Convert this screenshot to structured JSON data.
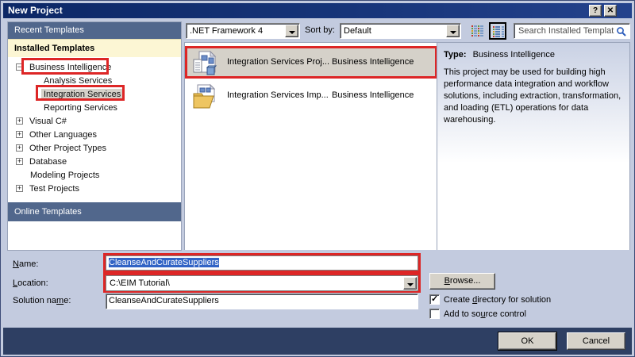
{
  "window": {
    "title": "New Project",
    "help_glyph": "?",
    "close_glyph": "✕"
  },
  "toolbar": {
    "framework_value": ".NET Framework 4",
    "sort_label": "Sort by:",
    "sort_value": "Default",
    "search_placeholder": "Search Installed Templat"
  },
  "sidebar": {
    "recent_header": "Recent Templates",
    "installed_header": "Installed Templates",
    "online_header": "Online Templates",
    "tree": [
      {
        "label": "Business Intelligence",
        "exp": "−"
      },
      {
        "label": "Analysis Services",
        "exp": ""
      },
      {
        "label": "Integration Services",
        "exp": ""
      },
      {
        "label": "Reporting Services",
        "exp": ""
      },
      {
        "label": "Visual C#",
        "exp": "+"
      },
      {
        "label": "Other Languages",
        "exp": "+"
      },
      {
        "label": "Other Project Types",
        "exp": "+"
      },
      {
        "label": "Database",
        "exp": "+"
      },
      {
        "label": "Modeling Projects",
        "exp": ""
      },
      {
        "label": "Test Projects",
        "exp": "+"
      }
    ]
  },
  "templates": [
    {
      "name": "Integration Services Proj...",
      "type": "Business Intelligence",
      "icon": "integration-services-project",
      "selected": true
    },
    {
      "name": "Integration Services Imp...",
      "type": "Business Intelligence",
      "icon": "import-project-wizard",
      "selected": false
    }
  ],
  "description": {
    "type_label": "Type:",
    "type_value": "Business Intelligence",
    "body": "This project may be used for building high performance data integration and workflow solutions, including extraction, transformation, and loading (ETL) operations for data warehousing."
  },
  "form": {
    "name_label": {
      "pre": "",
      "u": "N",
      "post": "ame:"
    },
    "name_value": "CleanseAndCurateSuppliers",
    "location_label": {
      "pre": "",
      "u": "L",
      "post": "ocation:"
    },
    "location_value": "C:\\EIM Tutorial\\",
    "solution_label": {
      "pre": "Solution na",
      "u": "m",
      "post": "e:"
    },
    "solution_value": "CleanseAndCurateSuppliers",
    "browse_label": {
      "pre": "",
      "u": "B",
      "post": "rowse..."
    },
    "create_dir_label": {
      "pre": "Create ",
      "u": "d",
      "post": "irectory for solution"
    },
    "create_dir_checked": true,
    "check_glyph": "✓",
    "source_control_label": {
      "pre": "Add to so",
      "u": "u",
      "post": "rce control"
    },
    "source_control_checked": false
  },
  "footer": {
    "ok": "OK",
    "cancel": "Cancel"
  },
  "colors": {
    "annotation_red": "#dd2626",
    "title_navy": "#0c2766",
    "footer_navy": "#2e3f63",
    "header_slate": "#51678c",
    "header_cream": "#fcf6d4",
    "selection_blue": "#3163c5",
    "selected_row_gray": "#d5d1c9"
  }
}
